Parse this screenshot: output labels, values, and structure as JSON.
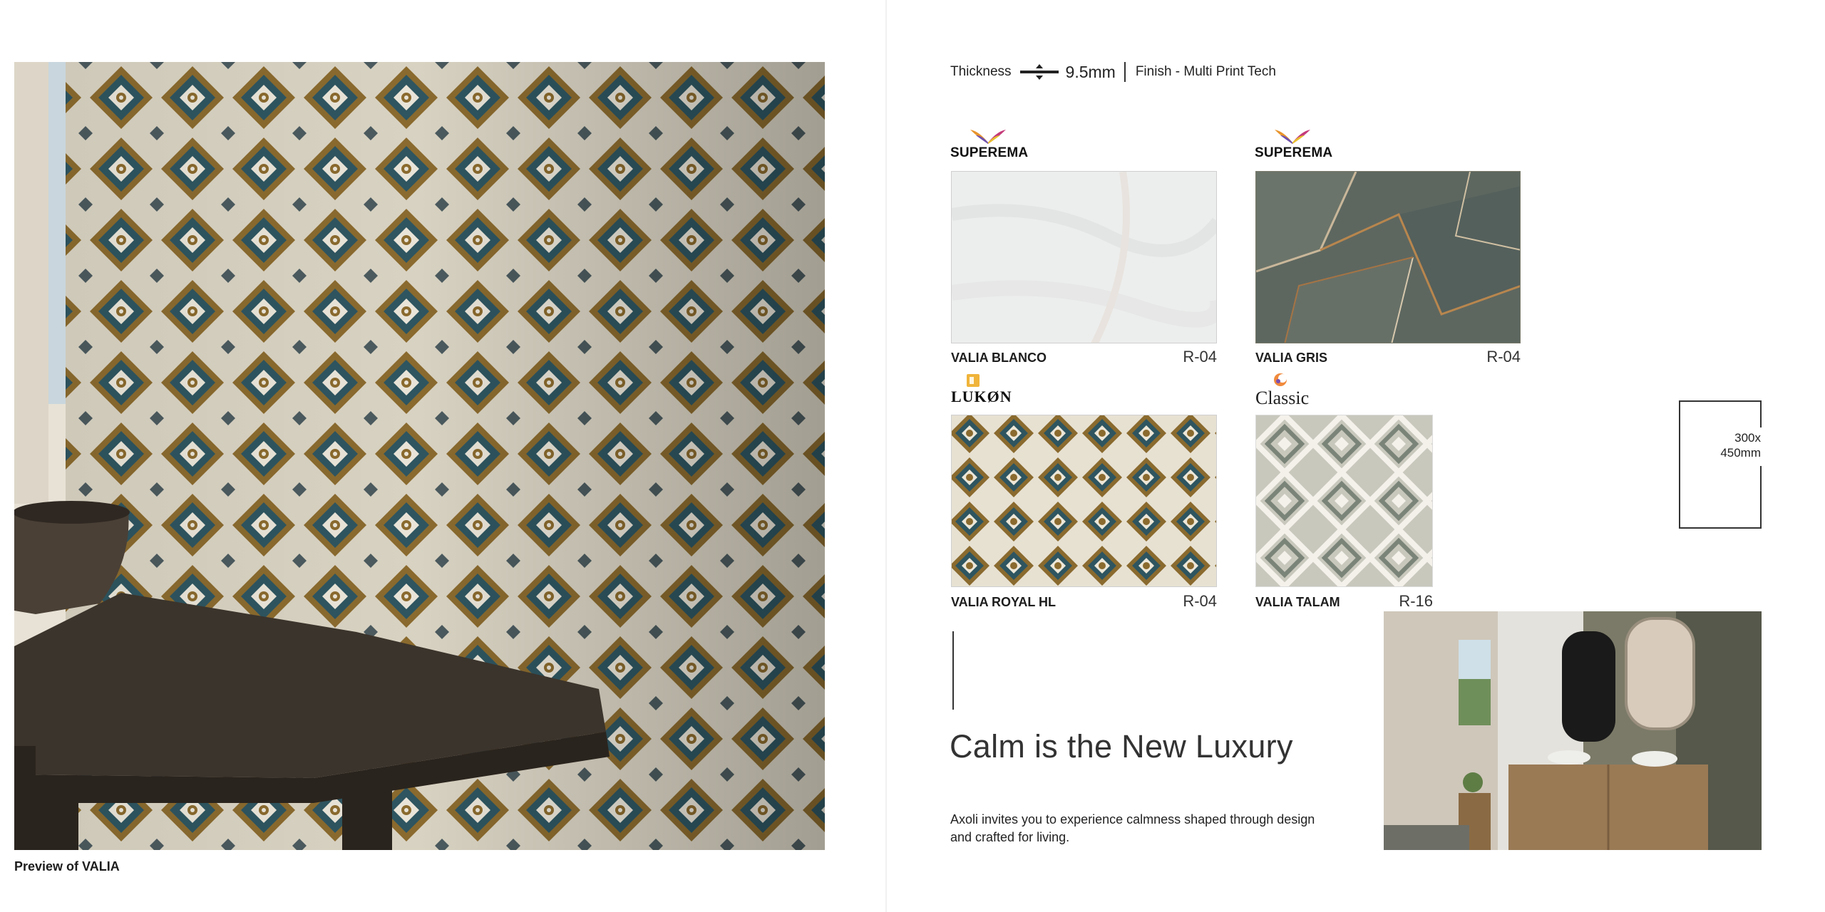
{
  "left_page": {
    "caption": "Preview of VALIA"
  },
  "spec": {
    "thickness_label": "Thickness",
    "thickness_value": "9.5mm",
    "finish_label": "Finish - Multi Print Tech"
  },
  "brands": {
    "superema": "SUPEREMA",
    "lukon": "LUKØN",
    "classic": "Classic"
  },
  "tiles": [
    {
      "name": "VALIA BLANCO",
      "code": "R-04",
      "brand": "SUPEREMA"
    },
    {
      "name": "VALIA GRIS",
      "code": "R-04",
      "brand": "SUPEREMA"
    },
    {
      "name": "VALIA ROYAL HL",
      "code": "R-04",
      "brand": "LUKØN"
    },
    {
      "name": "VALIA TALAM",
      "code": "R-16",
      "brand": "Classic"
    }
  ],
  "size": {
    "line1": "300x",
    "line2": "450mm"
  },
  "tagline": {
    "headline": "Calm is the New Luxury",
    "body": "Axoli invites you to experience calmness shaped through design and crafted for living."
  },
  "colors": {
    "ochre": "#8a6a2e",
    "teal": "#2e5560",
    "cream": "#e9e4d8",
    "wood": "#3b342c"
  }
}
